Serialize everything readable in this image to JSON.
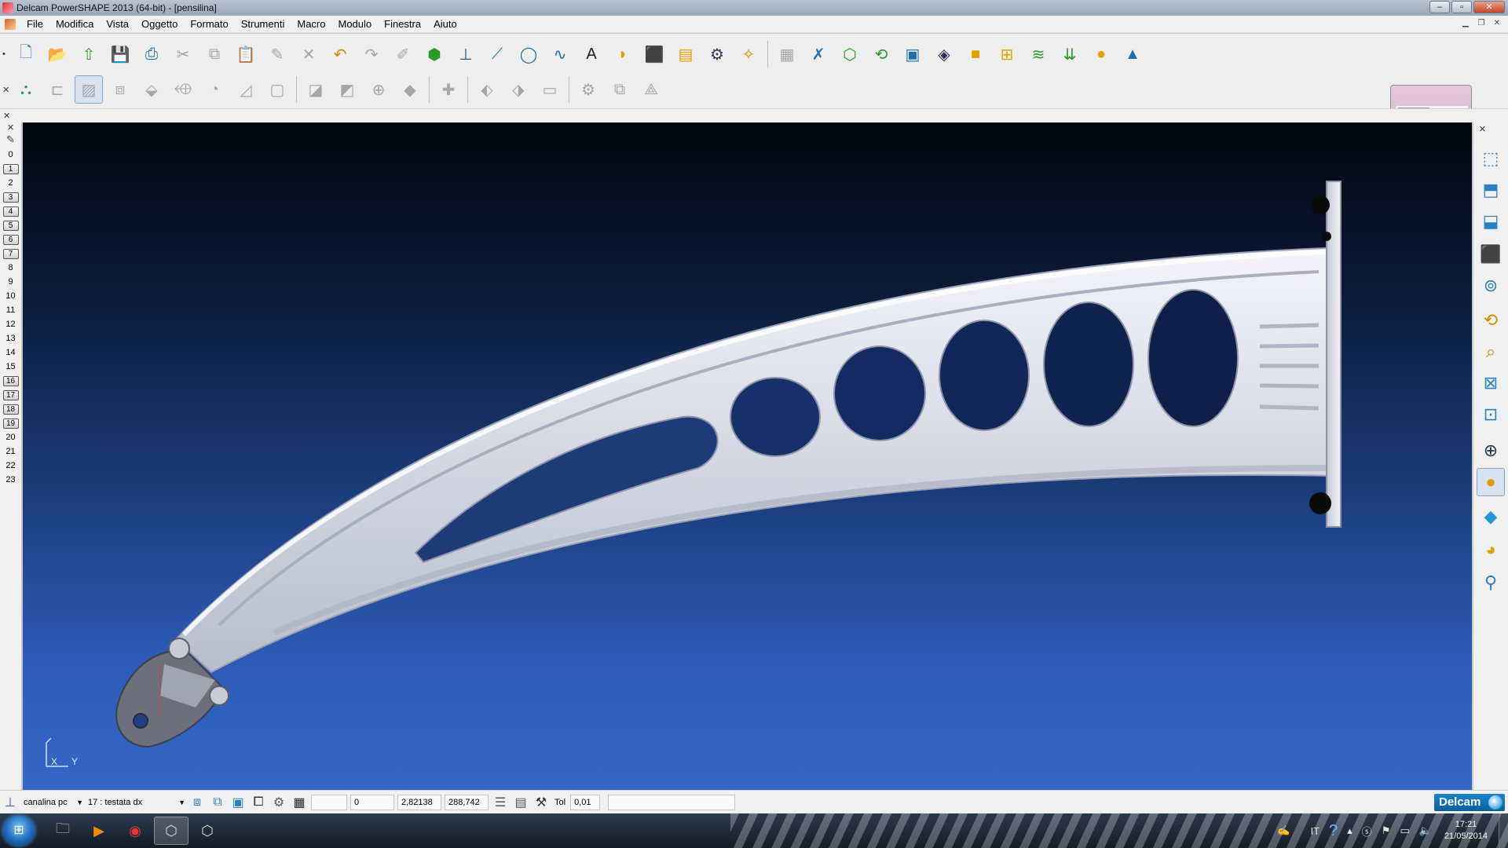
{
  "window": {
    "title": "Delcam PowerSHAPE 2013 (64-bit) - [pensilina]",
    "controls": [
      "–",
      "▫",
      "✕"
    ]
  },
  "menu": {
    "items": [
      "File",
      "Modifica",
      "Vista",
      "Oggetto",
      "Formato",
      "Strumenti",
      "Macro",
      "Modulo",
      "Finestra",
      "Aiuto"
    ]
  },
  "levels": {
    "list": [
      "0",
      "1",
      "2",
      "3",
      "4",
      "5",
      "6",
      "7",
      "8",
      "9",
      "10",
      "11",
      "12",
      "13",
      "14",
      "15",
      "16",
      "17",
      "18",
      "19",
      "20",
      "21",
      "22",
      "23"
    ],
    "used": [
      "1",
      "3",
      "4",
      "5",
      "6",
      "7",
      "16",
      "17",
      "18",
      "19"
    ]
  },
  "viewport": {
    "axis_label_x": "X",
    "axis_label_y": "Y"
  },
  "statusbar": {
    "workplane": "canalina pc",
    "level": "17 : testata dx",
    "field_a": "0",
    "field_b": "2,82138",
    "field_c": "288,742",
    "tol_label": "Tol",
    "tol_value": "0,01"
  },
  "brand": {
    "logo_text": "Delcam"
  },
  "taskbar": {
    "language": "IT",
    "time": "17:21",
    "date": "21/05/2014"
  },
  "colors": {
    "viewport_top": "#02060f",
    "viewport_bottom": "#3667c6",
    "part_fill": "#d7dae6",
    "accent": "#1a84c8"
  }
}
